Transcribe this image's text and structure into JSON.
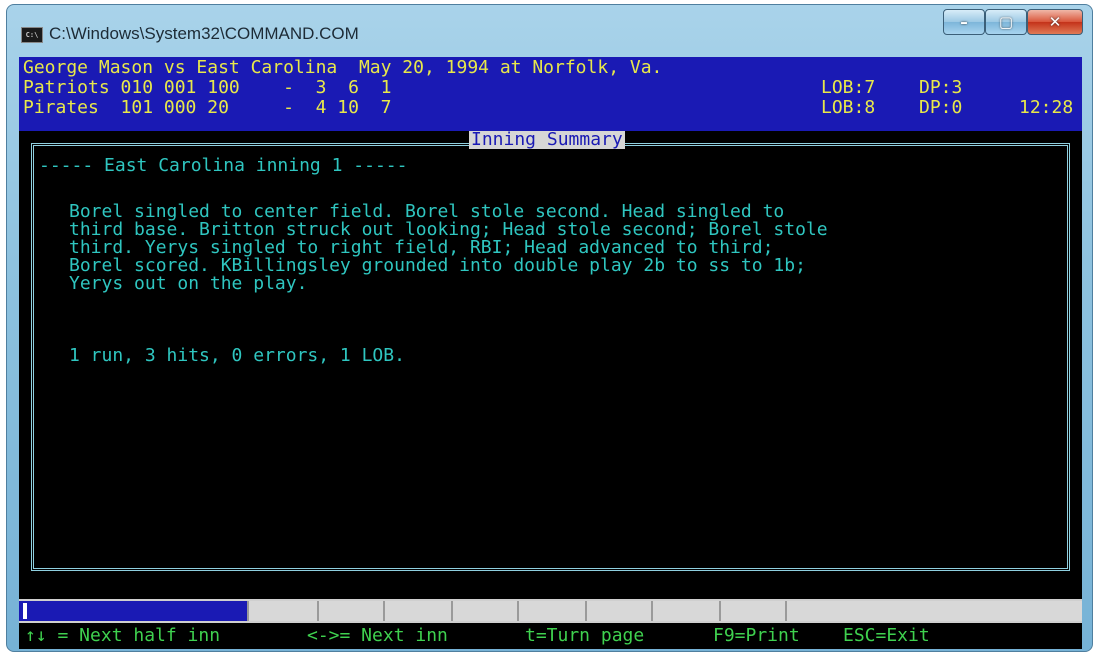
{
  "window": {
    "title": "C:\\Windows\\System32\\COMMAND.COM",
    "icon_text": "C:\\",
    "controls": {
      "minimize": "–",
      "maximize": "▢",
      "close": "✕"
    }
  },
  "header": {
    "matchup": "George Mason vs East Carolina  May 20, 1994 at Norfolk, Va.",
    "teams": [
      {
        "line": "Patriots 010 001 100    -  3  6  1",
        "lob": "LOB:7",
        "dp": "DP:3"
      },
      {
        "line": "Pirates  101 000 20     -  4 10  7",
        "lob": "LOB:8",
        "dp": "DP:0"
      }
    ],
    "time": "12:28"
  },
  "panel": {
    "title": "Inning Summary",
    "inning_heading": "----- East Carolina inning 1 -----",
    "paragraph_lines": [
      "Borel singled to center field. Borel stole second. Head singled to",
      "third base. Britton struck out looking; Head stole second; Borel stole",
      "third. Yerys singled to right field, RBI; Head advanced to third;",
      "Borel scored. KBillingsley grounded into double play 2b to ss to 1b;",
      "Yerys out on the play."
    ],
    "summary": "1 run, 3 hits, 0 errors, 1 LOB."
  },
  "footer": {
    "next_half": "↑↓ = Next half inn",
    "next_inn": "<->= Next inn",
    "turn_page": "t=Turn page",
    "print": "F9=Print",
    "exit": "ESC=Exit"
  },
  "colors": {
    "header_bg": "#1a1ab4",
    "header_text": "#e8e84a",
    "body_text": "#2fc6c0",
    "footer_text": "#3fd14f",
    "panel_border": "#8fd0e0"
  }
}
